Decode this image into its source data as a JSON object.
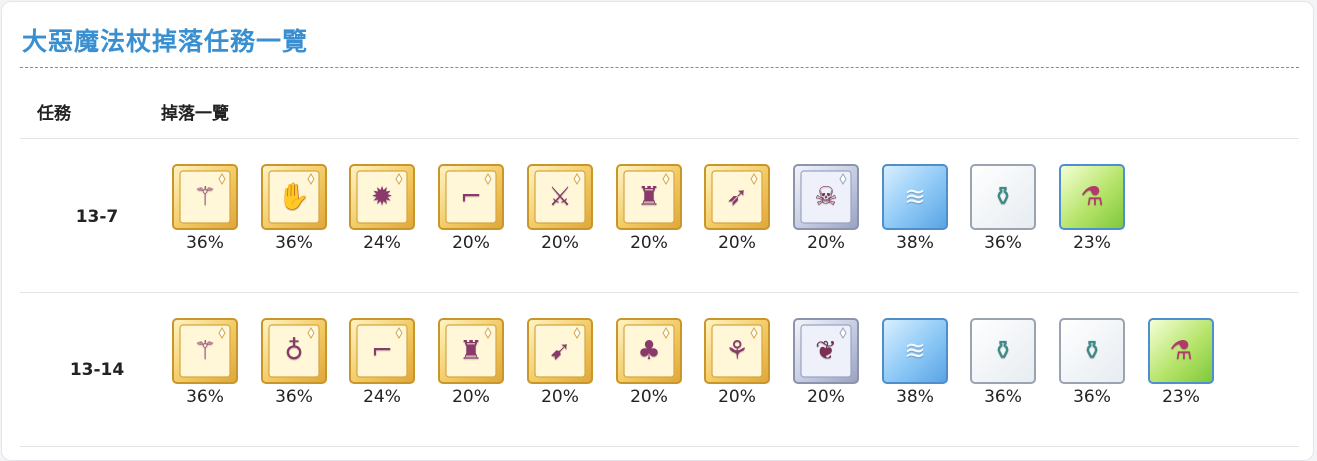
{
  "page_title": "大惡魔法杖掉落任務一覽",
  "table": {
    "headers": {
      "quest": "任務",
      "drops": "掉落一覽"
    },
    "rows": [
      {
        "quest": "13-7",
        "drops": [
          {
            "icon": "staff-equipment-icon",
            "glyph": "⚚",
            "frame": "gold",
            "rate": "36%"
          },
          {
            "icon": "gauntlet-equipment-icon",
            "glyph": "✋",
            "frame": "gold",
            "rate": "36%"
          },
          {
            "icon": "amulet-equipment-icon",
            "glyph": "✹",
            "frame": "gold",
            "rate": "24%"
          },
          {
            "icon": "boots-equipment-icon",
            "glyph": "⌐",
            "frame": "gold",
            "rate": "20%"
          },
          {
            "icon": "sword-equipment-icon",
            "glyph": "⚔",
            "frame": "gold",
            "rate": "20%"
          },
          {
            "icon": "robe-equipment-icon",
            "glyph": "♜",
            "frame": "gold",
            "rate": "20%"
          },
          {
            "icon": "spear-equipment-icon",
            "glyph": "➶",
            "frame": "gold",
            "rate": "20%"
          },
          {
            "icon": "skull-pendant-equipment-icon",
            "glyph": "☠",
            "frame": "silver",
            "rate": "20%"
          },
          {
            "icon": "ticket-icon",
            "glyph": "≋",
            "frame": "blue",
            "rate": "38%"
          },
          {
            "icon": "gold-pot-icon",
            "glyph": "⚱",
            "frame": "white",
            "rate": "36%"
          },
          {
            "icon": "potion-icon",
            "glyph": "⚗",
            "frame": "green",
            "rate": "23%"
          }
        ]
      },
      {
        "quest": "13-14",
        "drops": [
          {
            "icon": "staff-equipment-icon",
            "glyph": "⚚",
            "frame": "gold",
            "rate": "36%"
          },
          {
            "icon": "pouch-equipment-icon",
            "glyph": "♁",
            "frame": "gold",
            "rate": "36%"
          },
          {
            "icon": "boots-equipment-icon",
            "glyph": "⌐",
            "frame": "gold",
            "rate": "24%"
          },
          {
            "icon": "cloak-equipment-icon",
            "glyph": "♜",
            "frame": "gold",
            "rate": "20%"
          },
          {
            "icon": "bow-equipment-icon",
            "glyph": "➹",
            "frame": "gold",
            "rate": "20%"
          },
          {
            "icon": "dress-equipment-icon",
            "glyph": "♣",
            "frame": "gold",
            "rate": "20%"
          },
          {
            "icon": "wand-equipment-icon",
            "glyph": "⚘",
            "frame": "gold",
            "rate": "20%"
          },
          {
            "icon": "laurel-necklace-equipment-icon",
            "glyph": "❦",
            "frame": "silver",
            "rate": "20%"
          },
          {
            "icon": "ticket-icon",
            "glyph": "≋",
            "frame": "blue",
            "rate": "38%"
          },
          {
            "icon": "gold-pot-icon",
            "glyph": "⚱",
            "frame": "white",
            "rate": "36%"
          },
          {
            "icon": "gold-pot-icon",
            "glyph": "⚱",
            "frame": "white",
            "rate": "36%"
          },
          {
            "icon": "potion-icon",
            "glyph": "⚗",
            "frame": "green",
            "rate": "23%"
          }
        ]
      }
    ]
  },
  "colors": {
    "title": "#3a8fd0",
    "title_rule": "#4a9fc9",
    "glyph": {
      "gold": "#8a3a6a",
      "silver": "#7a3050",
      "blue": "#f4f8ff",
      "white": "#3f8a86",
      "green": "#b03a6a"
    }
  }
}
